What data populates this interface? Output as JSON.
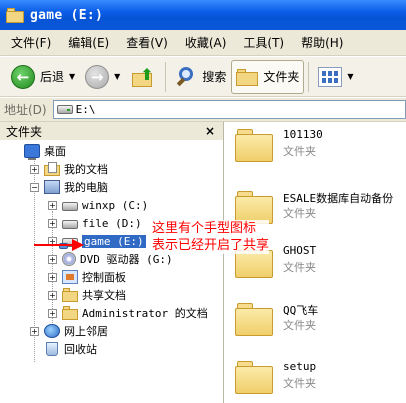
{
  "window": {
    "title": "game (E:)"
  },
  "menu": [
    "文件(F)",
    "编辑(E)",
    "查看(V)",
    "收藏(A)",
    "工具(T)",
    "帮助(H)"
  ],
  "toolbar": {
    "back_label": "后退",
    "search_label": "搜索",
    "folders_label": "文件夹"
  },
  "address": {
    "label": "地址(D)",
    "value": "E:\\"
  },
  "folder_pane": {
    "title": "文件夹",
    "close_glyph": "×",
    "tree": {
      "desktop": "桌面",
      "my_documents": "我的文档",
      "my_computer": "我的电脑",
      "drive_c": "winxp (C:)",
      "drive_d": "file (D:)",
      "drive_e": "game (E:)",
      "drive_dvd": "DVD 驱动器 (G:)",
      "control_panel": "控制面板",
      "shared_docs": "共享文档",
      "admin_docs": "Administrator 的文档",
      "network": "网上邻居",
      "recycle_bin": "回收站"
    }
  },
  "content": {
    "items": [
      {
        "name": "101130",
        "type": "文件夹"
      },
      {
        "name": "ESALE数据库自动备份",
        "type": "文件夹"
      },
      {
        "name": "GHOST",
        "type": "文件夹"
      },
      {
        "name": "QQ飞车",
        "type": "文件夹"
      },
      {
        "name": "setup",
        "type": "文件夹"
      }
    ]
  },
  "annotation": {
    "line1": "这里有个手型图标",
    "line2": "表示已经开启了共享"
  },
  "colors": {
    "titlebar": "#0a5ce6",
    "selection": "#316ac5",
    "annotation": "#ff0000",
    "folder": "#f3d682"
  }
}
